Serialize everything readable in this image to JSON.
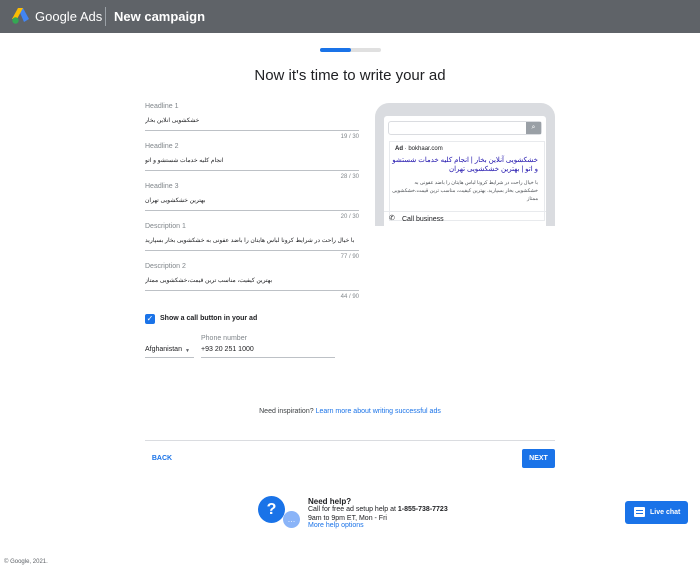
{
  "header": {
    "brand": "Google Ads",
    "page": "New campaign"
  },
  "progress": {
    "percent": 50
  },
  "title": "Now it's time to write your ad",
  "fields": [
    {
      "label": "Headline 1",
      "value": "خشکشویی آنلاین بخار",
      "count": "19 / 30"
    },
    {
      "label": "Headline 2",
      "value": "انجام کلیه خدمات شستشو و اتو",
      "count": "28 / 30"
    },
    {
      "label": "Headline 3",
      "value": "بهترین خشکشویی تهران",
      "count": "20 / 30"
    },
    {
      "label": "Description 1",
      "value": "با خیال راحت در شرایط کرونا لباس هایتان را باضد عفونی به خشکشویی بخار بسپارید",
      "count": "77 / 90"
    },
    {
      "label": "Description 2",
      "value": "بهترین کیفیت، مناسب ترین قیمت،خشکشویی ممتاز",
      "count": "44 / 90"
    }
  ],
  "call": {
    "checkbox_label": "Show a call button in your ad",
    "country": "Afghanistan",
    "phone_label": "Phone number",
    "phone_value": "+93 20 251 1000"
  },
  "preview": {
    "ad_badge": "Ad",
    "domain": "bokhaar.com",
    "headline": "خشکشویی آنلاین بخار | انجام کلیه خدمات شستشو و اتو | بهترین خشکشویی تهران",
    "description": "با خیال راحت در شرایط کرونا لباس هایتان را باضد عفونی به خشکشویی بخار بسپارید. بهترین کیفیت، مناسب ترین قیمت،خشکشویی ممتاز",
    "call_label": "Call business"
  },
  "inspiration": {
    "prefix": "Need inspiration?",
    "link": "Learn more about writing successful ads"
  },
  "nav": {
    "back": "BACK",
    "next": "NEXT"
  },
  "help": {
    "title": "Need help?",
    "line1_prefix": "Call for free ad setup help at",
    "phone": "1-855-738-7723",
    "line2": "9am to 9pm ET, Mon - Fri",
    "link": "More help options"
  },
  "live_chat": "Live chat",
  "footer": "© Google, 2021."
}
